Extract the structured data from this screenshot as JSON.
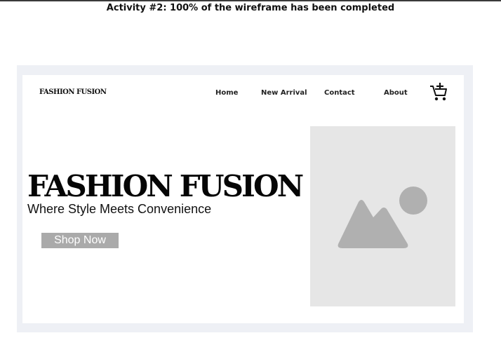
{
  "header": {
    "title": "Activity #2: 100% of the wireframe has been completed"
  },
  "site": {
    "brand": "FASHION FUSION",
    "nav": {
      "home": "Home",
      "new_arrival": "New Arrival",
      "contact": "Contact",
      "about": "About"
    },
    "cart_icon": "cart-add-icon"
  },
  "hero": {
    "title": "FASHION FUSION",
    "subtitle": "Where Style Meets Convenience",
    "cta_label": "Shop Now",
    "image_icon": "image-placeholder-icon"
  },
  "colors": {
    "frame_bg": "#eef0f5",
    "button_bg": "#aaaaaa",
    "image_bg": "#e6e6e6",
    "image_shapes": "#b0b0b0"
  }
}
